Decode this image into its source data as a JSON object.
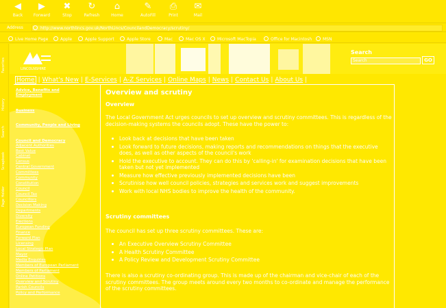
{
  "toolbar": {
    "buttons": [
      {
        "label": "Back",
        "icon": "back-arrow-icon"
      },
      {
        "label": "Forward",
        "icon": "forward-arrow-icon"
      },
      {
        "label": "Stop",
        "icon": "stop-icon"
      },
      {
        "label": "Refresh",
        "icon": "refresh-icon"
      },
      {
        "label": "Home",
        "icon": "home-icon"
      },
      {
        "label": "AutoFill",
        "icon": "autofill-icon"
      },
      {
        "label": "Print",
        "icon": "print-icon"
      },
      {
        "label": "Mail",
        "icon": "mail-icon"
      }
    ]
  },
  "address_bar": {
    "label": "Address",
    "url": "http://www.northlincs.gov.uk/NorthLincs/CouncilandDemocracy/scrutiny/"
  },
  "links_bar": {
    "items": [
      "Live Home Page",
      "Apple",
      "Apple Support",
      "Apple Store",
      "Mac",
      "Mac OS X",
      "Microsoft MacTopia",
      "Office for Macintosh",
      "MSN"
    ]
  },
  "explorer_tabs": [
    "Favorites",
    "History",
    "Search",
    "Scrapbook",
    "Page Holder"
  ],
  "header": {
    "logo_text": "LINCOLNSHIRE",
    "search_label": "Search",
    "search_value": "Search",
    "search_button": "GO"
  },
  "nav": {
    "items": [
      "Home",
      "What's New",
      "E-Services",
      "A-Z Services",
      "Online Maps",
      "News",
      "Contact Us",
      "About Us"
    ]
  },
  "sidebar": {
    "headings": [
      "Advice, Benefits and Employment",
      "Business",
      "Community, People and Living",
      "Council and Democracy"
    ],
    "items": [
      "Adjacent Authorities",
      "Best Value",
      "Cabinet",
      "Census",
      "Central Government",
      "Committees",
      "Community",
      "Constitution",
      "Council",
      "Council Tax",
      "Councillors",
      "Decision Making",
      "Departments",
      "Diversity",
      "Elections",
      "European Funding",
      "Finance",
      "Forward Plan",
      "Licensing",
      "Local Strategic Plan",
      "Mayor",
      "Media Enquiries",
      "Members of European Parliament",
      "Members of Parliament",
      "Online Petitions",
      "Overview and Scrutiny",
      "Parish Councils",
      "Policy and Performance"
    ]
  },
  "main": {
    "title": "Overview and scrutiny",
    "section1": "Overview",
    "para1": "The Local Government Act urges councils to set up overview and scrutiny committees. This is regardless of the decision-making systems the councils adopt. These have the power to:",
    "powers": [
      "Look back at decisions that have been taken",
      "Look forward to future decisions, making reports and recommendations on things that the executive does, as well as other aspects of the council's work",
      "Hold the executive to account. They can do this by 'calling-in' for examination decisions that have been taken but not yet implemented",
      "Measure how effective previously implemented decisions have been",
      "Scrutinise how well council policies, strategies and services work and suggest improvements",
      "Work with local NHS bodies to improve the health of the community."
    ],
    "section2": "Scrutiny committees",
    "para2": "The council has set up three scrutiny committees. These are:",
    "committees": [
      "An Executive Overview Scrutiny Committee",
      "A Health Scrutiny Committee",
      "A Policy Review and Development Scrutiny Committee"
    ],
    "para3": "There is also a scrutiny co-ordinating group. This is made up of the chairman and vice-chair of each of the scrutiny committees. The group meets around every two months to co-ordinate and manage the performance of the scrutiny committees."
  },
  "colors": {
    "background": "#ffe800",
    "text": "#ffffff"
  }
}
